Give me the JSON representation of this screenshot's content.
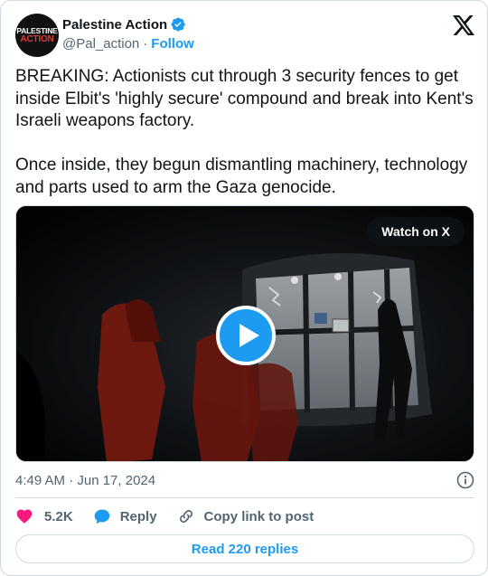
{
  "author": {
    "display_name": "Palestine Action",
    "handle": "@Pal_action",
    "separator": "·",
    "follow_label": "Follow",
    "avatar_line1": "PALESTINE",
    "avatar_line2": "ACTION",
    "verified": true
  },
  "post": {
    "paragraph1": "BREAKING: Actionists cut through 3 security fences to get inside Elbit's 'highly secure' compound and break into Kent's Israeli weapons factory.",
    "paragraph2": "Once inside, they begun dismantling machinery, technology and parts used to arm the Gaza genocide."
  },
  "media": {
    "type": "video",
    "watch_label": "Watch on X",
    "play_icon": "play-icon"
  },
  "meta": {
    "timestamp": "4:49 AM · Jun 17, 2024"
  },
  "actions": {
    "like_count": "5.2K",
    "reply_label": "Reply",
    "copy_label": "Copy link to post"
  },
  "footer": {
    "read_replies_label": "Read 220 replies"
  },
  "colors": {
    "accent": "#1d9bf0",
    "like": "#f91880",
    "text": "#0f1419",
    "secondary": "#536471",
    "border": "#cfd9de"
  }
}
